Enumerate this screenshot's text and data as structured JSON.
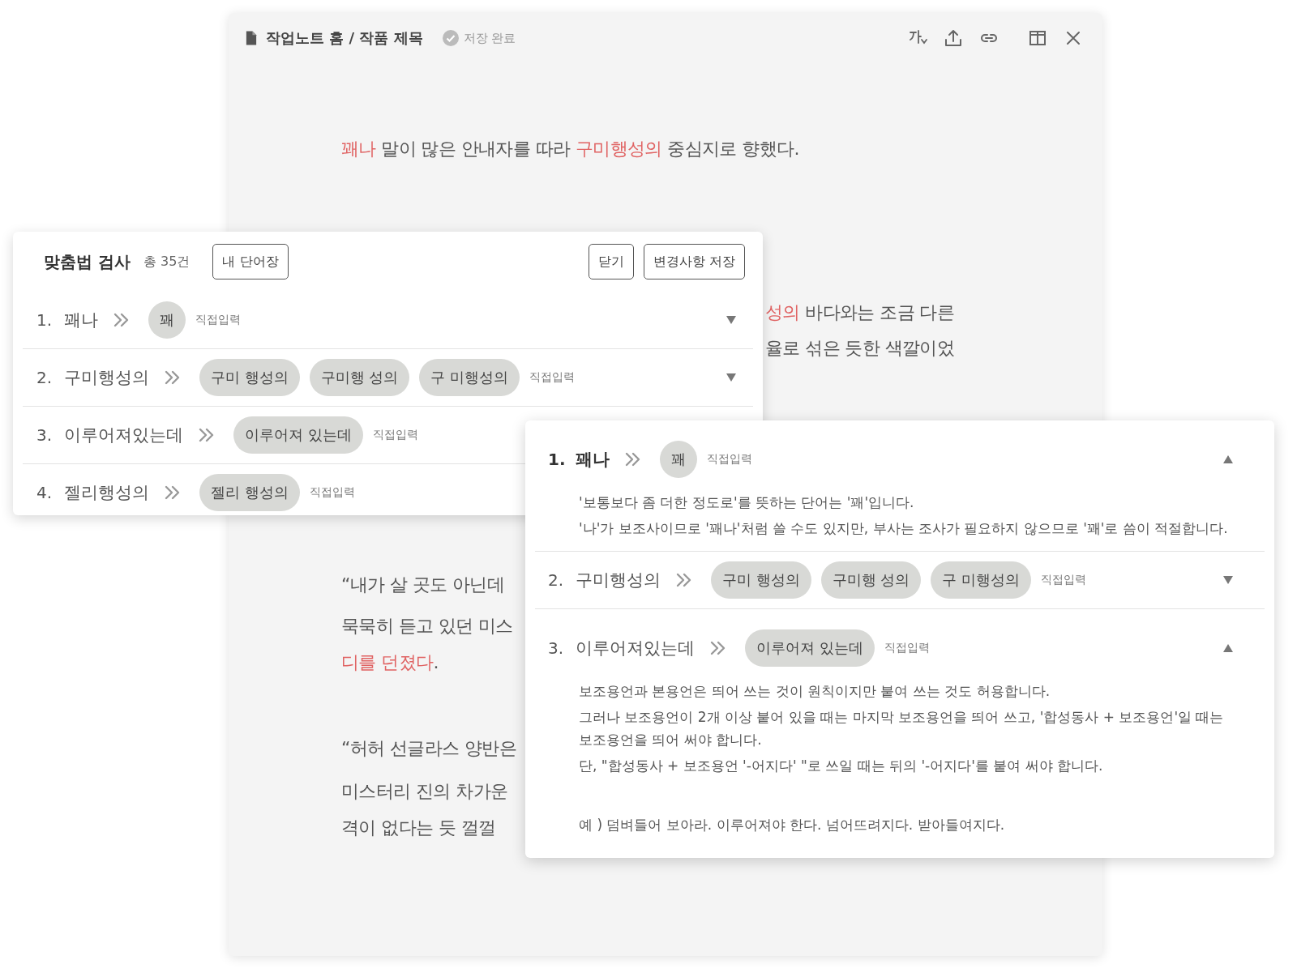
{
  "document": {
    "title": "작업노트 홈 / 작품 제목",
    "save_status": "저장 완료",
    "lines": [
      {
        "segments": [
          {
            "text": "꽤나",
            "flagged": true
          },
          {
            "text": " 말이 많은 안내자를 따라 ",
            "flagged": false
          },
          {
            "text": "구미행성의",
            "flagged": true
          },
          {
            "text": " 중심지로 향했다.",
            "flagged": false
          }
        ]
      },
      {
        "segments": [
          {
            "text": "성의",
            "flagged": true
          },
          {
            "text": " 바다와는 조금 다른",
            "flagged": false
          }
        ]
      },
      {
        "segments": [
          {
            "text": "율로 섞은 듯한 색깔이었",
            "flagged": false
          }
        ]
      },
      {
        "segments": [
          {
            "text": "“내가 살 곳도 아닌데",
            "flagged": false
          }
        ]
      },
      {
        "segments": [
          {
            "text": "묵묵히 듣고 있던 미스",
            "flagged": false
          }
        ]
      },
      {
        "segments": [
          {
            "text": "디를 던졌다",
            "flagged": true
          },
          {
            "text": ".",
            "flagged": false
          }
        ]
      },
      {
        "segments": [
          {
            "text": "“허허 선글라스 양반은",
            "flagged": false
          }
        ]
      },
      {
        "segments": [
          {
            "text": "미스터리 진의 차가운",
            "flagged": false
          }
        ]
      },
      {
        "segments": [
          {
            "text": "격이 없다는 듯 껄껄",
            "flagged": false
          }
        ]
      }
    ]
  },
  "spellcheck_panel": {
    "title": "맞춤법 검사",
    "count": "총 35건",
    "wordbook_button": "내 단어장",
    "actions": [
      "닫기",
      "변경사항 저장"
    ],
    "items": [
      {
        "number": "1.",
        "word": "꽤나",
        "suggestions": [
          "꽤"
        ],
        "direct_input": "직접입력",
        "expanded": false
      },
      {
        "number": "2.",
        "word": "구미행성의",
        "suggestions": [
          "구미 행성의",
          "구미행 성의",
          "구 미행성의"
        ],
        "direct_input": "직접입력",
        "expanded": false
      },
      {
        "number": "3.",
        "word": "이루어져있는데",
        "suggestions": [
          "이루어져 있는데"
        ],
        "direct_input": "직접입력"
      },
      {
        "number": "4.",
        "word": "젤리행성의",
        "suggestions": [
          "젤리 행성의"
        ],
        "direct_input": "직접입력"
      }
    ]
  },
  "detail_panel": {
    "items": [
      {
        "number": "1.",
        "word": "꽤나",
        "selected": true,
        "suggestions": [
          "꽤"
        ],
        "direct_input": "직접입력",
        "expanded": true,
        "explanation": [
          {
            "kind": "note",
            "text": "'보통보다 좀 더한 정도로'를 뜻하는 단어는 '꽤'입니다."
          },
          {
            "kind": "note",
            "text": "'나'가 보조사이므로 '꽤나'처럼 쓸 수도 있지만, 부사는 조사가 필요하지 않으므로 '꽤'로 씀이 적절합니다."
          }
        ]
      },
      {
        "number": "2.",
        "word": "구미행성의",
        "selected": false,
        "suggestions": [
          "구미 행성의",
          "구미행 성의",
          "구 미행성의"
        ],
        "direct_input": "직접입력",
        "expanded": false
      },
      {
        "number": "3.",
        "word": "이루어져있는데",
        "selected": false,
        "suggestions": [
          "이루어져 있는데"
        ],
        "direct_input": "직접입력",
        "expanded": true,
        "explanation": [
          {
            "kind": "note",
            "text": "보조용언과 본용언은 띄어 쓰는 것이 원칙이지만 붙여 쓰는 것도 허용합니다."
          },
          {
            "kind": "note",
            "text": "그러나 보조용언이 2개 이상 붙어 있을 때는 마지막 보조용언을 띄어 쓰고, '합성동사 + 보조용언'일 때는 보조용언을 띄어 써야 합니다."
          },
          {
            "kind": "note",
            "text": "단, \"합성동사 + 보조용언 '-어지다' \"로 쓰일 때는 뒤의 '-어지다'를 붙여 써야 합니다."
          },
          {
            "kind": "example",
            "text": "예 ) 덤벼들어 보아라. 이루어져야 한다. 넘어뜨려지다. 받아들여지다."
          }
        ]
      }
    ]
  }
}
